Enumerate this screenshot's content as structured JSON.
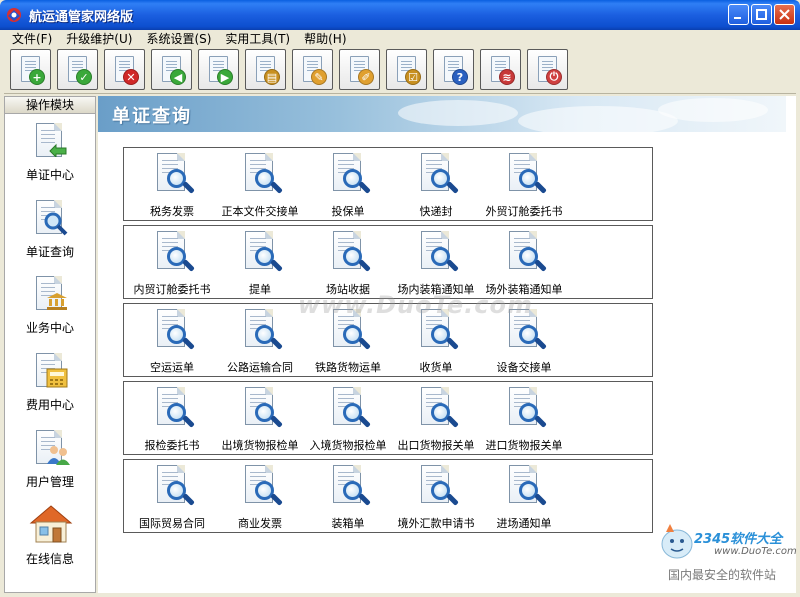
{
  "window": {
    "title": "航运通管家网络版"
  },
  "menu": [
    "文件(F)",
    "升级维护(U)",
    "系统设置(S)",
    "实用工具(T)",
    "帮助(H)"
  ],
  "toolbar": [
    {
      "name": "add-icon",
      "glyph": "+",
      "color": "#3aa83a"
    },
    {
      "name": "confirm-icon",
      "glyph": "✓",
      "color": "#3aa83a"
    },
    {
      "name": "delete-icon",
      "glyph": "✕",
      "color": "#d02828"
    },
    {
      "name": "back-icon",
      "glyph": "◀",
      "color": "#3aa83a"
    },
    {
      "name": "forward-icon",
      "glyph": "▶",
      "color": "#3aa83a"
    },
    {
      "name": "bank-icon",
      "glyph": "▤",
      "color": "#c89020"
    },
    {
      "name": "edit-icon",
      "glyph": "✎",
      "color": "#e0a030"
    },
    {
      "name": "note-icon",
      "glyph": "✐",
      "color": "#e0a030"
    },
    {
      "name": "check-doc-icon",
      "glyph": "☑",
      "color": "#c89020"
    },
    {
      "name": "help-icon",
      "glyph": "?",
      "color": "#2a60c0"
    },
    {
      "name": "chart-icon",
      "glyph": "≋",
      "color": "#c83838"
    },
    {
      "name": "exit-icon",
      "glyph": "⏻",
      "color": "#d04040"
    }
  ],
  "sidebar": {
    "header": "操作模块",
    "items": [
      {
        "label": "单证中心",
        "icon": "doc-center-icon"
      },
      {
        "label": "单证查询",
        "icon": "doc-search-icon"
      },
      {
        "label": "业务中心",
        "icon": "bank-doc-icon"
      },
      {
        "label": "费用中心",
        "icon": "calculator-doc-icon"
      },
      {
        "label": "用户管理",
        "icon": "users-doc-icon"
      },
      {
        "label": "在线信息",
        "icon": "house-icon"
      }
    ]
  },
  "main": {
    "title": "单证查询",
    "groups": [
      [
        "税务发票",
        "正本文件交接单",
        "投保单",
        "快递封",
        "外贸订舱委托书"
      ],
      [
        "内贸订舱委托书",
        "提单",
        "场站收据",
        "场内装箱通知单",
        "场外装箱通知单"
      ],
      [
        "空运运单",
        "公路运输合同",
        "铁路货物运单",
        "收货单",
        "设备交接单"
      ],
      [
        "报检委托书",
        "出境货物报检单",
        "入境货物报检单",
        "出口货物报关单",
        "进口货物报关单"
      ],
      [
        "国际贸易合同",
        "商业发票",
        "装箱单",
        "境外汇款申请书",
        "进场通知单"
      ]
    ]
  },
  "watermark": "www.DuoTe.com",
  "logo": {
    "site": "2345软件大全",
    "url": "www.DuoTe.com",
    "tagline": "国内最安全的软件站"
  }
}
